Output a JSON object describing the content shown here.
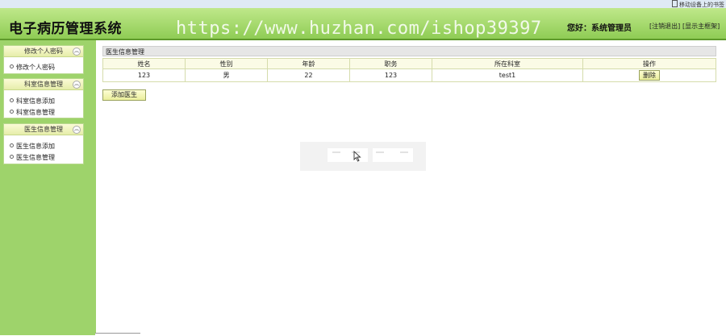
{
  "topbar": {
    "bookmark_label": "移动设备上的书签"
  },
  "header": {
    "title": "电子病历管理系统",
    "watermark": "https://www.huzhan.com/ishop39397",
    "greeting": "您好：系统管理员",
    "logout_label": "[注销退出]",
    "homepage_label": "[显示主框架]"
  },
  "sidebar": {
    "panels": [
      {
        "title": "修改个人密码",
        "items": [
          "修改个人密码"
        ]
      },
      {
        "title": "科室信息管理",
        "items": [
          "科室信息添加",
          "科室信息管理"
        ]
      },
      {
        "title": "医生信息管理",
        "items": [
          "医生信息添加",
          "医生信息管理"
        ]
      }
    ]
  },
  "main": {
    "section_title": "医生信息管理",
    "columns": [
      "姓名",
      "性别",
      "年龄",
      "职务",
      "所在科室",
      "操作"
    ],
    "rows": [
      {
        "name": "123",
        "gender": "男",
        "age": "22",
        "position": "123",
        "department": "test1",
        "action": "删除"
      }
    ],
    "add_button_label": "添加医生"
  },
  "colors": {
    "header_green": "#8fcc55",
    "sidebar_green": "#9ed36b",
    "button_yellow": "#ebef9c"
  },
  "icons": {
    "collapse": "double-chevron-up-icon",
    "cursor": "mouse-pointer-icon"
  }
}
